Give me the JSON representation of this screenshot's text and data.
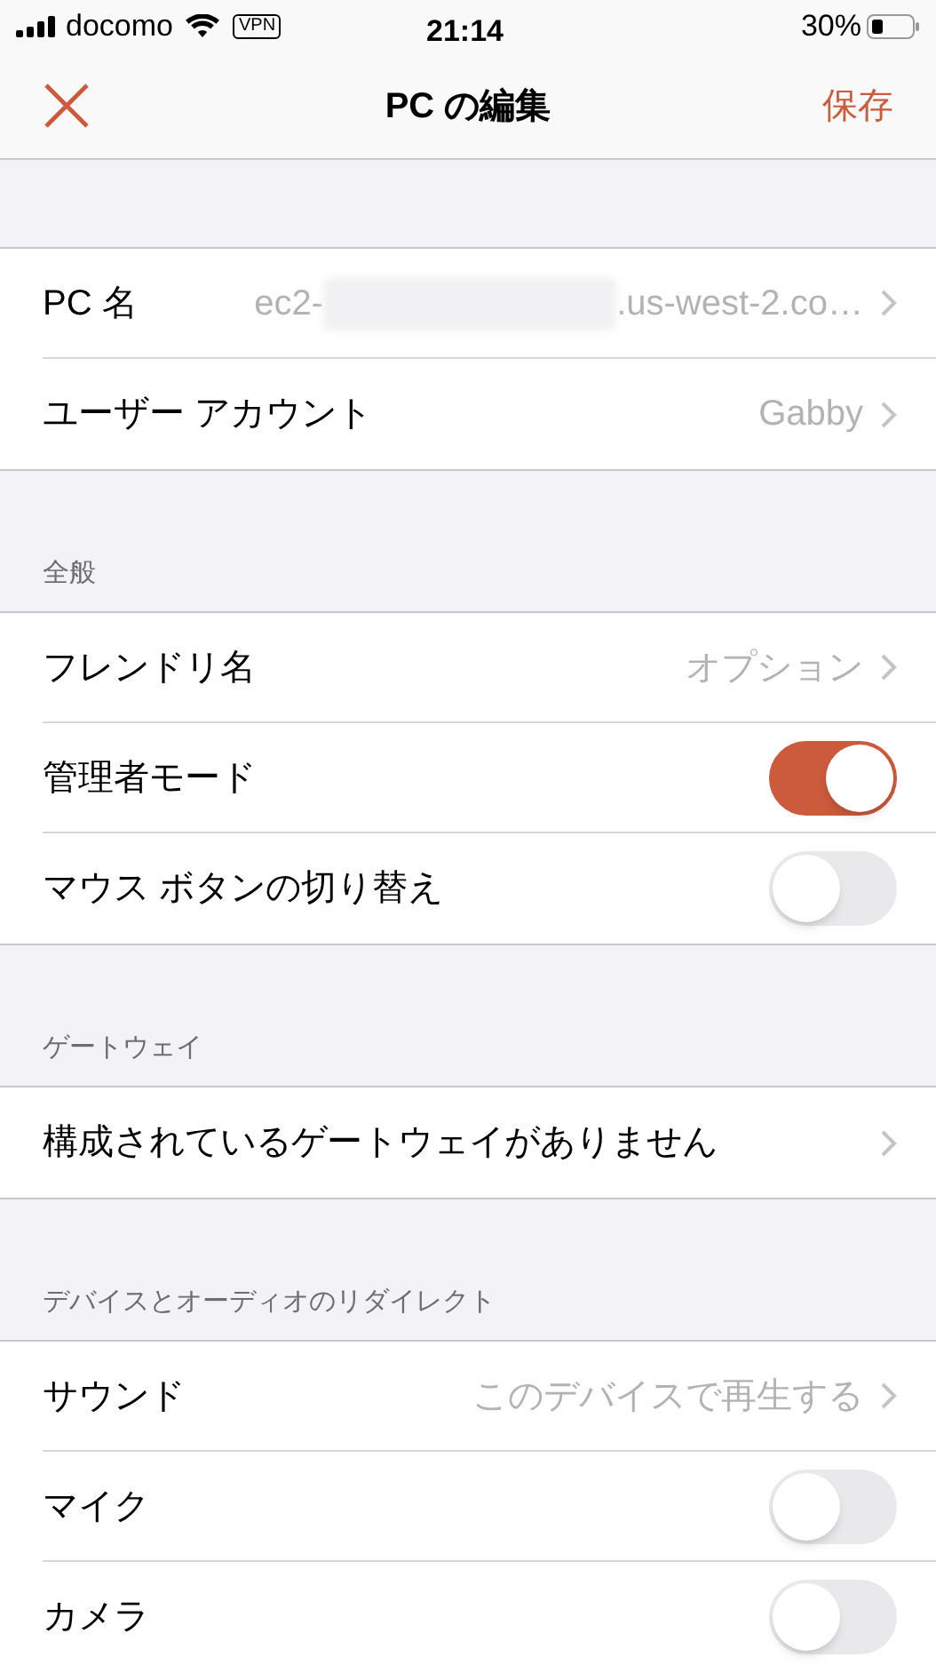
{
  "status_bar": {
    "carrier": "docomo",
    "vpn": "VPN",
    "time": "21:14",
    "battery": "30%"
  },
  "nav": {
    "title": "PC の編集",
    "save": "保存"
  },
  "sections": [
    {
      "rows": [
        {
          "kind": "link",
          "label": "PC 名",
          "value_prefix": "ec2-",
          "value_suffix": ".us-west-2.co…",
          "redacted": true
        },
        {
          "kind": "link",
          "label": "ユーザー アカウント",
          "value": "Gabby"
        }
      ]
    },
    {
      "header": "全般",
      "rows": [
        {
          "kind": "link",
          "label": "フレンドリ名",
          "value": "オプション"
        },
        {
          "kind": "toggle",
          "label": "管理者モード",
          "on": true
        },
        {
          "kind": "toggle",
          "label": "マウス ボタンの切り替え",
          "on": false
        }
      ]
    },
    {
      "header": "ゲートウェイ",
      "rows": [
        {
          "kind": "link",
          "label": "構成されているゲートウェイがありません"
        }
      ]
    },
    {
      "header": "デバイスとオーディオのリダイレクト",
      "rows": [
        {
          "kind": "link",
          "label": "サウンド",
          "value": "このデバイスで再生する"
        },
        {
          "kind": "toggle",
          "label": "マイク",
          "on": false
        },
        {
          "kind": "toggle",
          "label": "カメラ",
          "on": false
        }
      ]
    }
  ]
}
